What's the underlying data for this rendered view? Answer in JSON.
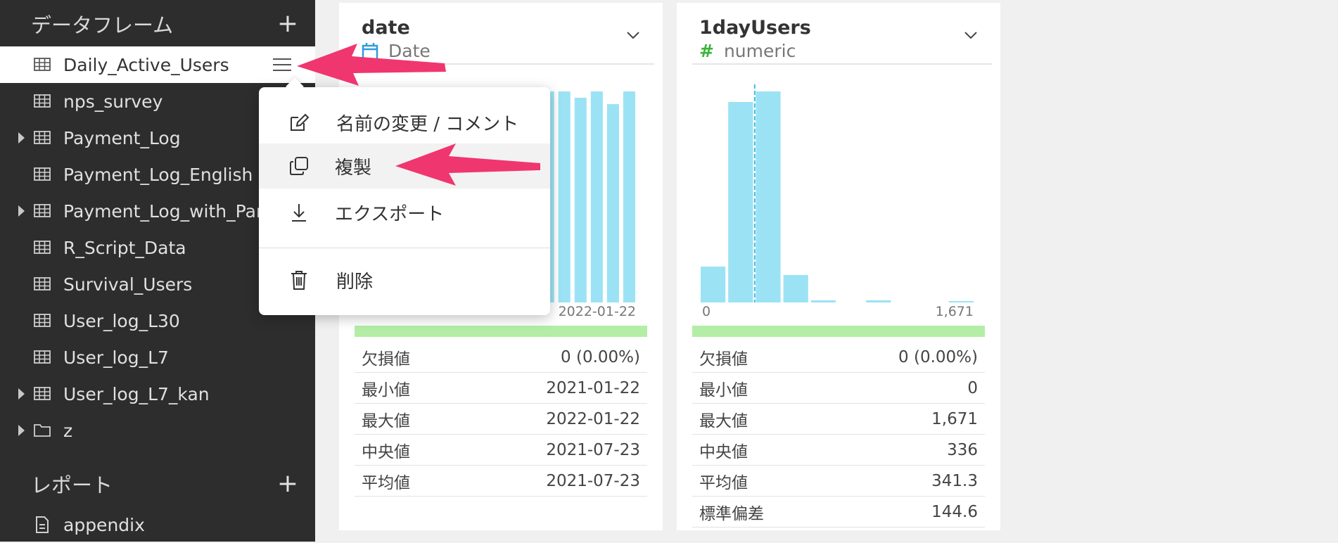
{
  "sidebar": {
    "dataframes_header": "データフレーム",
    "reports_header": "レポート",
    "add_icon": "plus-icon",
    "items": [
      {
        "label": "Daily_Active_Users",
        "expandable": false,
        "icon": "table-icon",
        "active": true
      },
      {
        "label": "nps_survey",
        "expandable": false,
        "icon": "table-icon"
      },
      {
        "label": "Payment_Log",
        "expandable": true,
        "icon": "table-icon"
      },
      {
        "label": "Payment_Log_English",
        "expandable": false,
        "icon": "table-icon"
      },
      {
        "label": "Payment_Log_with_Para",
        "expandable": true,
        "icon": "table-icon"
      },
      {
        "label": "R_Script_Data",
        "expandable": false,
        "icon": "table-icon"
      },
      {
        "label": "Survival_Users",
        "expandable": false,
        "icon": "table-icon"
      },
      {
        "label": "User_log_L30",
        "expandable": false,
        "icon": "table-icon"
      },
      {
        "label": "User_log_L7",
        "expandable": false,
        "icon": "table-icon"
      },
      {
        "label": "User_log_L7_kan",
        "expandable": true,
        "icon": "table-icon"
      },
      {
        "label": "z",
        "expandable": true,
        "icon": "folder-icon"
      }
    ],
    "reports": [
      {
        "label": "appendix",
        "icon": "document-icon"
      }
    ]
  },
  "menu": {
    "items": [
      {
        "label": "名前の変更 / コメント",
        "icon": "edit-icon"
      },
      {
        "label": "複製",
        "icon": "copy-icon",
        "highlighted": true
      },
      {
        "label": "エクスポート",
        "icon": "download-icon"
      },
      {
        "label": "削除",
        "icon": "trash-icon"
      }
    ]
  },
  "columns": [
    {
      "name": "date",
      "type": "Date",
      "type_icon": "calendar-icon",
      "axis_min": "",
      "axis_max": "2022-01-22",
      "stats": [
        {
          "label": "欠損値",
          "value": "0 (0.00%)"
        },
        {
          "label": "最小値",
          "value": "2021-01-22"
        },
        {
          "label": "最大値",
          "value": "2022-01-22"
        },
        {
          "label": "中央値",
          "value": "2021-07-23"
        },
        {
          "label": "平均値",
          "value": "2021-07-23"
        }
      ]
    },
    {
      "name": "1dayUsers",
      "type": "numeric",
      "type_icon": "hash-icon",
      "axis_min": "0",
      "axis_max": "1,671",
      "stats": [
        {
          "label": "欠損値",
          "value": "0 (0.00%)"
        },
        {
          "label": "最小値",
          "value": "0"
        },
        {
          "label": "最大値",
          "value": "1,671"
        },
        {
          "label": "中央値",
          "value": "336"
        },
        {
          "label": "平均値",
          "value": "341.3"
        },
        {
          "label": "標準偏差",
          "value": "144.6"
        }
      ]
    }
  ],
  "colors": {
    "bar": "#9be3f4",
    "median_line": "#43bde0",
    "green_bar": "#b4eda6",
    "arrow": "#f0366f",
    "calendar_icon": "#2f9be0",
    "hash_icon": "#3cb43c"
  },
  "chart_data": [
    {
      "type": "bar",
      "series": [
        {
          "values": [
            100,
            100,
            100,
            100,
            100,
            100,
            100,
            100,
            100,
            100,
            100,
            100,
            100,
            97,
            100,
            94,
            100
          ]
        }
      ],
      "xlim": [
        "",
        "2022-01-22"
      ],
      "ylim": [
        0,
        100
      ]
    },
    {
      "type": "bar",
      "x_range": [
        0,
        1671
      ],
      "median": 336,
      "series": [
        {
          "values": [
            17,
            95,
            100,
            13,
            1,
            0,
            1,
            0,
            0,
            0.5
          ]
        }
      ],
      "ylim": [
        0,
        100
      ]
    }
  ]
}
